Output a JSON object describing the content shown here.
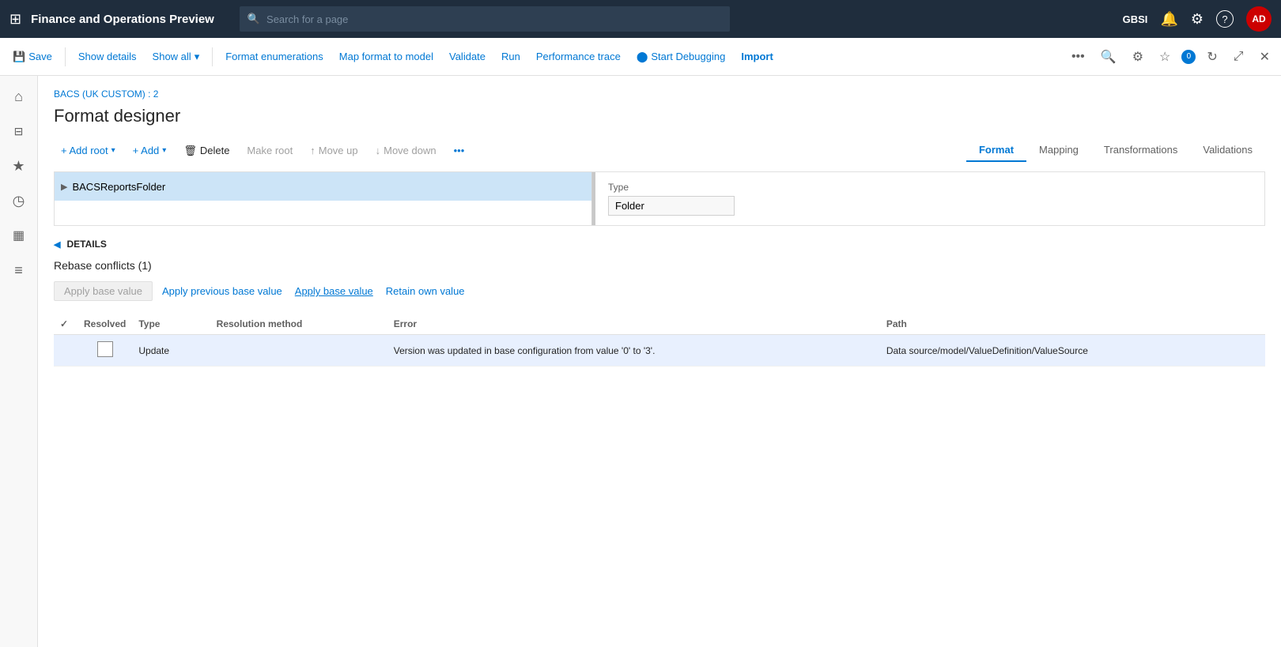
{
  "topNav": {
    "gridIconLabel": "⊞",
    "title": "Finance and Operations Preview",
    "searchPlaceholder": "Search for a page",
    "userCode": "GBSI",
    "avatarInitials": "AD",
    "bellIcon": "🔔",
    "gearIcon": "⚙",
    "helpIcon": "?"
  },
  "toolbar": {
    "saveLabel": "Save",
    "showDetailsLabel": "Show details",
    "showAllLabel": "Show all",
    "showAllCaret": "▾",
    "formatEnumerationsLabel": "Format enumerations",
    "mapFormatToModelLabel": "Map format to model",
    "validateLabel": "Validate",
    "runLabel": "Run",
    "performanceTraceLabel": "Performance trace",
    "startDebuggingLabel": "Start Debugging",
    "importLabel": "Import",
    "moreIcon": "•••",
    "searchIcon": "🔍",
    "settingsIcon": "⚙",
    "favouriteIcon": "☆",
    "notifCount": "0",
    "refreshIcon": "↻",
    "popoutIcon": "⤢",
    "closeIcon": "✕"
  },
  "sidebar": {
    "homeIcon": "⌂",
    "starIcon": "★",
    "clockIcon": "◷",
    "listIcon": "☰",
    "filterIcon": "⊞",
    "bulletIcon": "≡"
  },
  "breadcrumb": "BACS (UK CUSTOM) : 2",
  "pageTitle": "Format designer",
  "actions": {
    "addRootLabel": "+ Add root",
    "addRootCaret": "▾",
    "addLabel": "+ Add",
    "addCaret": "▾",
    "deleteLabel": "Delete",
    "makeRootLabel": "Make root",
    "moveUpLabel": "Move up",
    "moveDownLabel": "Move down",
    "moreLabel": "•••"
  },
  "tabs": [
    {
      "key": "format",
      "label": "Format",
      "active": true
    },
    {
      "key": "mapping",
      "label": "Mapping",
      "active": false
    },
    {
      "key": "transformations",
      "label": "Transformations",
      "active": false
    },
    {
      "key": "validations",
      "label": "Validations",
      "active": false
    }
  ],
  "treeItem": {
    "label": "BACSReportsFolder",
    "expandIcon": "▶"
  },
  "rightPanel": {
    "typeLabel": "Type",
    "typeValue": "Folder"
  },
  "details": {
    "sectionLabel": "DETAILS",
    "collapseIcon": "◀",
    "rebaseTitle": "Rebase conflicts (1)",
    "applyPreviousBaseValueLabel": "Apply previous base value",
    "applyBaseValueLabel": "Apply base value",
    "retainOwnValueLabel": "Retain own value"
  },
  "table": {
    "columns": [
      {
        "key": "resolved",
        "label": "Resolved"
      },
      {
        "key": "type",
        "label": "Type"
      },
      {
        "key": "resolution_method",
        "label": "Resolution method"
      },
      {
        "key": "error",
        "label": "Error"
      },
      {
        "key": "path",
        "label": "Path"
      }
    ],
    "rows": [
      {
        "resolved": false,
        "type": "Update",
        "resolution_method": "",
        "error": "Version was updated in base configuration from value '0' to '3'.",
        "path": "Data source/model/ValueDefinition/ValueSource"
      }
    ]
  }
}
